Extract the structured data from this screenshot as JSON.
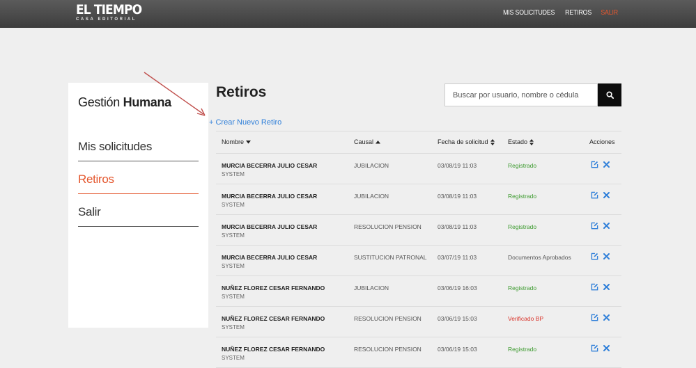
{
  "header": {
    "logo_title": "EL TIEMPO",
    "logo_subtitle": "CASA EDITORIAL",
    "nav": [
      {
        "label": "MIS SOLICITUDES"
      },
      {
        "label": "RETIROS"
      },
      {
        "label": "SALIR"
      }
    ]
  },
  "sidebar": {
    "title_light": "Gestión",
    "title_bold": "Humana",
    "items": [
      {
        "label": "Mis solicitudes"
      },
      {
        "label": "Retiros"
      },
      {
        "label": "Salir"
      }
    ]
  },
  "main": {
    "title": "Retiros",
    "search_placeholder": "Buscar por usuario, nombre o cédula",
    "create_link": "+ Crear Nuevo Retiro"
  },
  "table": {
    "columns": {
      "nombre": "Nombre",
      "causal": "Causal",
      "fecha": "Fecha de solicitud",
      "estado": "Estado",
      "acciones": "Acciones"
    },
    "rows": [
      {
        "name": "MURCIA BECERRA JULIO CESAR",
        "sub": "SYSTEM",
        "causal": "JUBILACION",
        "fecha": "03/08/19 11:03",
        "estado": "Registrado",
        "estado_color": "#3c9a2e"
      },
      {
        "name": "MURCIA BECERRA JULIO CESAR",
        "sub": "SYSTEM",
        "causal": "JUBILACION",
        "fecha": "03/08/19 11:03",
        "estado": "Registrado",
        "estado_color": "#3c9a2e"
      },
      {
        "name": "MURCIA BECERRA JULIO CESAR",
        "sub": "SYSTEM",
        "causal": "RESOLUCION PENSION",
        "fecha": "03/08/19 11:03",
        "estado": "Registrado",
        "estado_color": "#3c9a2e"
      },
      {
        "name": "MURCIA BECERRA JULIO CESAR",
        "sub": "SYSTEM",
        "causal": "SUSTITUCION PATRONAL",
        "fecha": "03/07/19 11:03",
        "estado": "Documentos Aprobados",
        "estado_color": "#555555"
      },
      {
        "name": "NUÑEZ FLOREZ CESAR FERNANDO",
        "sub": "SYSTEM",
        "causal": "JUBILACION",
        "fecha": "03/06/19 16:03",
        "estado": "Registrado",
        "estado_color": "#3c9a2e"
      },
      {
        "name": "NUÑEZ FLOREZ CESAR FERNANDO",
        "sub": "SYSTEM",
        "causal": "RESOLUCION PENSION",
        "fecha": "03/06/19 15:03",
        "estado": "Verificado BP",
        "estado_color": "#d9342b"
      },
      {
        "name": "NUÑEZ FLOREZ CESAR FERNANDO",
        "sub": "SYSTEM",
        "causal": "RESOLUCION PENSION",
        "fecha": "03/06/19 15:03",
        "estado": "Registrado",
        "estado_color": "#3c9a2e"
      }
    ]
  },
  "colors": {
    "accent": "#e4572e",
    "link": "#2f7fd9",
    "action_icon": "#2f7fd9",
    "status_green": "#3c9a2e",
    "status_red": "#d9342b"
  },
  "icons": {
    "search": "search-icon",
    "edit": "edit-icon",
    "delete": "close-icon",
    "sort_down": "caret-down-icon",
    "sort_up": "caret-up-icon",
    "sort_both": "sort-icon",
    "annotation": "arrow-icon"
  }
}
